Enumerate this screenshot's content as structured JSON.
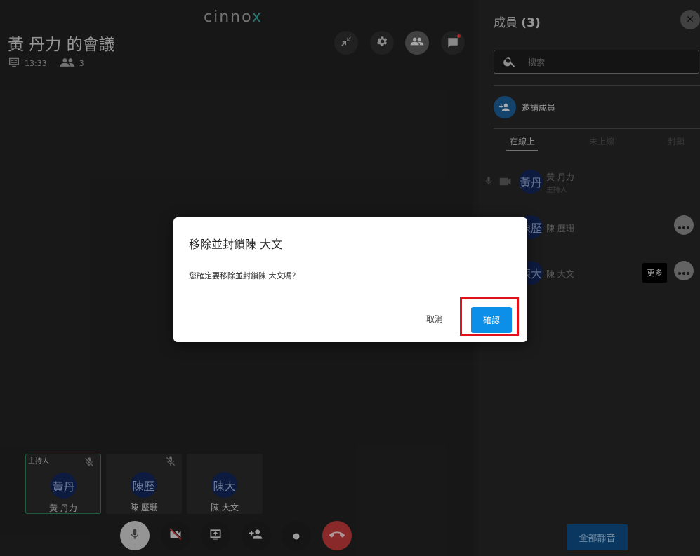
{
  "brand": {
    "logo_main": "cinno",
    "logo_x": "x"
  },
  "meeting": {
    "title": "黃 丹力 的會議",
    "time": "13:33",
    "participant_count": "3"
  },
  "tiles": [
    {
      "role": "主持人",
      "avatar": "黃丹",
      "name": "黃 丹力"
    },
    {
      "avatar": "陳歷",
      "name": "陳 歷珊"
    },
    {
      "avatar": "陳大",
      "name": "陳 大文"
    }
  ],
  "panel": {
    "title_label": "成員",
    "title_count": "(3)",
    "search_placeholder": "搜索",
    "invite_label": "邀請成員",
    "tabs": [
      "在線上",
      "未上線",
      "封鎖"
    ],
    "members": [
      {
        "avatar": "黃丹",
        "name": "黃 丹力",
        "sub": "主持人"
      },
      {
        "avatar": "陳歷",
        "name": "陳 歷珊"
      },
      {
        "avatar": "陳大",
        "name": "陳 大文"
      }
    ],
    "more_tooltip": "更多",
    "mute_all": "全部靜音"
  },
  "dialog": {
    "title": "移除並封鎖陳 大文",
    "message": "您確定要移除並封鎖陳 大文嗎？",
    "cancel": "取消",
    "confirm": "確認"
  },
  "colors": {
    "accent": "#0b8fe8",
    "highlight": "#e0121b",
    "end_call": "#c0393b",
    "avatar": "#13265a"
  }
}
